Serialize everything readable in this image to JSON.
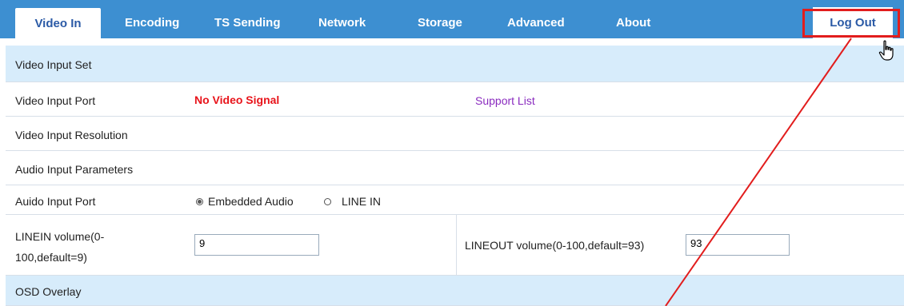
{
  "tabs": [
    {
      "label": "Video In"
    },
    {
      "label": "Encoding"
    },
    {
      "label": "TS Sending"
    },
    {
      "label": "Network"
    },
    {
      "label": "Storage"
    },
    {
      "label": "Advanced"
    },
    {
      "label": "About"
    }
  ],
  "logout_label": "Log Out",
  "sections": {
    "video_input_set": "Video Input Set",
    "osd_overlay": "OSD Overlay"
  },
  "rows": {
    "video_input_port": {
      "label": "Video Input Port",
      "status": "No Video Signal",
      "link": "Support List"
    },
    "video_input_resolution": {
      "label": "Video Input Resolution"
    },
    "audio_input_parameters": {
      "label": "Audio Input Parameters"
    },
    "audio_input_port": {
      "label": "Auido Input Port",
      "options": [
        "Embedded Audio",
        "LINE IN"
      ],
      "selected": "Embedded Audio"
    },
    "linein_volume": {
      "label_line1": "LINEIN volume(0-",
      "label_line2": "100,default=9)",
      "value": "9"
    },
    "lineout_volume": {
      "label": "LINEOUT volume(0-100,default=93)",
      "value": "93"
    }
  },
  "colors": {
    "tabbar": "#3d8fd1",
    "section_bg": "#d7ecfb",
    "status_red": "#e8141b",
    "link_purple": "#8a2bbf",
    "annotation_red": "#e21d1d"
  }
}
